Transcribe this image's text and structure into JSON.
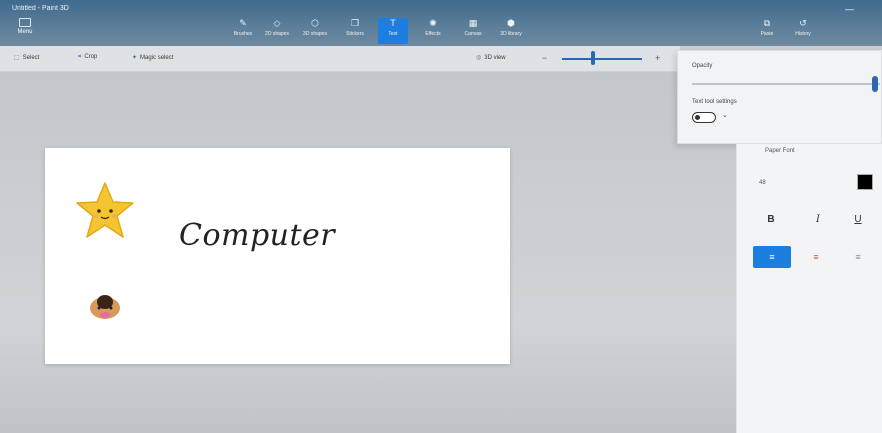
{
  "window": {
    "title": "Untitled - Paint 3D",
    "minimize_glyph": "—"
  },
  "menu": {
    "label": "Menu",
    "icon": "folder-icon"
  },
  "toolbar": {
    "tools": [
      {
        "label": "Brushes",
        "glyph": "✎",
        "icon": "brush-icon"
      },
      {
        "label": "2D shapes",
        "glyph": "◇",
        "icon": "shapes-2d-icon"
      },
      {
        "label": "3D shapes",
        "glyph": "⬡",
        "icon": "shapes-3d-icon"
      },
      {
        "label": "Stickers",
        "glyph": "❒",
        "icon": "sticker-icon"
      },
      {
        "label": "Text",
        "glyph": "T",
        "icon": "text-icon"
      },
      {
        "label": "Effects",
        "glyph": "✺",
        "icon": "effects-icon"
      },
      {
        "label": "Canvas",
        "glyph": "▦",
        "icon": "canvas-icon"
      },
      {
        "label": "3D library",
        "glyph": "⬢",
        "icon": "library-icon"
      }
    ],
    "active_tool": "Text",
    "right": [
      {
        "label": "Paste",
        "glyph": "⧉",
        "icon": "paste-icon"
      },
      {
        "label": "History",
        "glyph": "↺",
        "icon": "history-icon"
      }
    ]
  },
  "options": {
    "select_label": "Select",
    "crop_label": "Crop",
    "magic_label": "Magic select",
    "view_label": "3D view",
    "zoom_level": 0.5
  },
  "flyout": {
    "label_1": "Opacity",
    "label_2": "Text tool settings",
    "toggle_on": false
  },
  "canvas": {
    "text": "Computer"
  },
  "panel": {
    "title": "Paper Font",
    "size_value": "48",
    "text_color": "#000000",
    "bold": "B",
    "italic": "I",
    "underline": "U",
    "align_left": "≡",
    "align_center": "≡",
    "align_right": "≡"
  },
  "colors": {
    "accent": "#1c7fe0",
    "ribbon": "#4a7296",
    "canvas": "#ffffff"
  }
}
